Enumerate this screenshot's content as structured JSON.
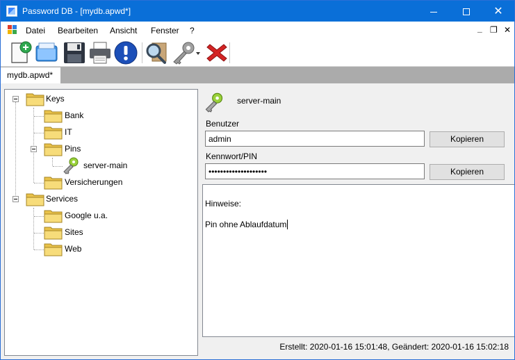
{
  "window": {
    "title": "Password DB - [mydb.apwd*]",
    "accent": "#0a6fd8"
  },
  "menu": {
    "items": [
      "Datei",
      "Bearbeiten",
      "Ansicht",
      "Fenster",
      "?"
    ]
  },
  "toolbar": {
    "buttons": [
      "new-entry-icon",
      "open-folder-icon",
      "save-icon",
      "print-icon",
      "info-icon",
      "search-icon",
      "key-icon",
      "delete-icon"
    ]
  },
  "tabs": [
    {
      "label": "mydb.apwd*",
      "active": true
    }
  ],
  "tree": {
    "nodes": [
      {
        "label": "Keys",
        "type": "folder",
        "level": 0,
        "expanded": true
      },
      {
        "label": "Bank",
        "type": "folder",
        "level": 1
      },
      {
        "label": "IT",
        "type": "folder",
        "level": 1
      },
      {
        "label": "Pins",
        "type": "folder",
        "level": 1,
        "expanded": true
      },
      {
        "label": "server-main",
        "type": "key",
        "level": 2,
        "selected": true
      },
      {
        "label": "Versicherungen",
        "type": "folder",
        "level": 1
      },
      {
        "label": "Services",
        "type": "folder",
        "level": 0,
        "expanded": true
      },
      {
        "label": "Google u.a.",
        "type": "folder",
        "level": 1
      },
      {
        "label": "Sites",
        "type": "folder",
        "level": 1
      },
      {
        "label": "Web",
        "type": "folder",
        "level": 1
      }
    ]
  },
  "detail": {
    "title": "server-main",
    "user_label": "Benutzer",
    "user_value": "admin",
    "password_label": "Kennwort/PIN",
    "password_value": "••••••••••••••••••••",
    "copy_label": "Kopieren",
    "notes_label": "Hinweise:",
    "notes_text": "Pin ohne Ablaufdatum"
  },
  "status": {
    "text": "Erstellt: 2020-01-16 15:01:48, Geändert: 2020-01-16 15:02:18"
  }
}
